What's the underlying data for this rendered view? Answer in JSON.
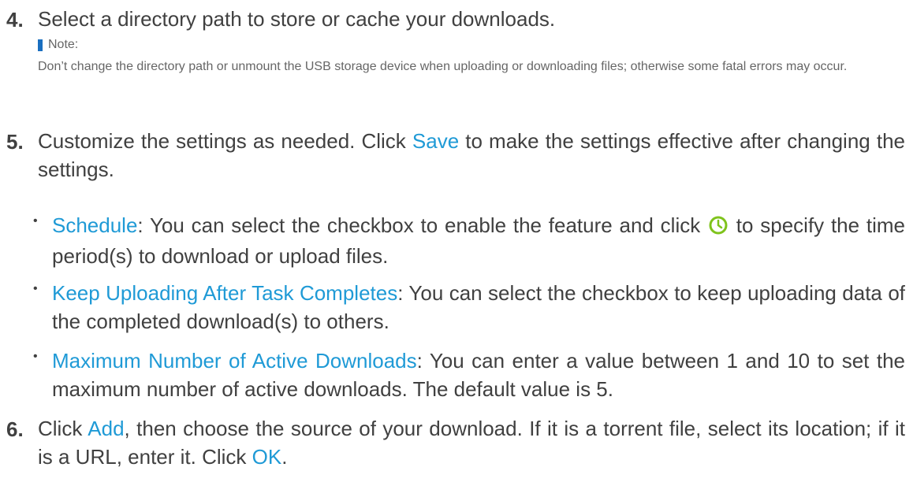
{
  "steps": {
    "s4": {
      "number": "4.",
      "text": "Select a directory path to store or cache your downloads.",
      "note_label": "Note:",
      "note_text": "Don’t change the directory path or unmount the USB storage device when uploading or downloading files; otherwise some fatal errors may occur."
    },
    "s5": {
      "number": "5.",
      "text_before": "Customize the settings as needed. Click ",
      "link_save": "Save",
      "text_after": " to make the settings effective after changing the settings.",
      "bullets": [
        {
          "term": "Schedule",
          "text_before_icon": ": You can select the checkbox to enable the feature and click ",
          "icon": "clock-icon",
          "text_after_icon": " to specify the time period(s) to download or upload files."
        },
        {
          "term": "Keep Uploading After Task Completes",
          "text": ": You can select the checkbox to keep uploading data of the completed download(s) to others."
        },
        {
          "term": "Maximum Number of Active Downloads",
          "text": ": You can enter a value between 1 and 10  to set the maximum number of active downloads. The default value is 5."
        }
      ]
    },
    "s6": {
      "number": "6.",
      "text_1": "Click ",
      "link_add": "Add",
      "text_2": ", then choose the source of your download. If it is a torrent file, select its location; if it is a URL, enter it. Click ",
      "link_ok": "OK",
      "text_3": "."
    }
  },
  "colors": {
    "text": "#404040",
    "link": "#1f9ad6",
    "note": "#666666",
    "note_marker": "#1a6fc0",
    "clock_icon": "#7fc31c"
  }
}
